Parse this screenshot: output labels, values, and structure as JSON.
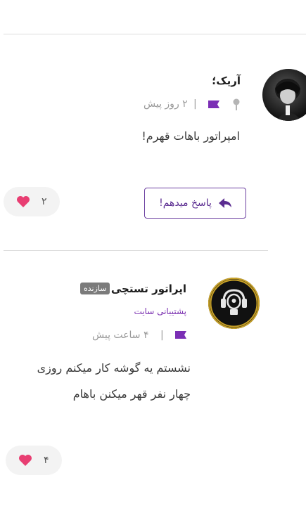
{
  "comments": [
    {
      "author": "آریک؛",
      "time": "۲ روز پیش",
      "separator": "|",
      "text": "امپراتور باهات قهرم!",
      "reply_label": "پاسخ میدهم!",
      "likes": "۲"
    },
    {
      "author": "اپراتور تستچی",
      "badge": "سازنده",
      "role": "پشتیبانی سایت",
      "time": "۴ ساعت پیش",
      "separator": "|",
      "text_line1": "نشستم یه گوشه کار میکنم روزی",
      "text_line2": "چهار نفر قهر میکنن باهام",
      "likes": "۴"
    }
  ],
  "colors": {
    "accent": "#6b3fa0",
    "heart": "#e83e72",
    "flag": "#7b2fb5"
  }
}
